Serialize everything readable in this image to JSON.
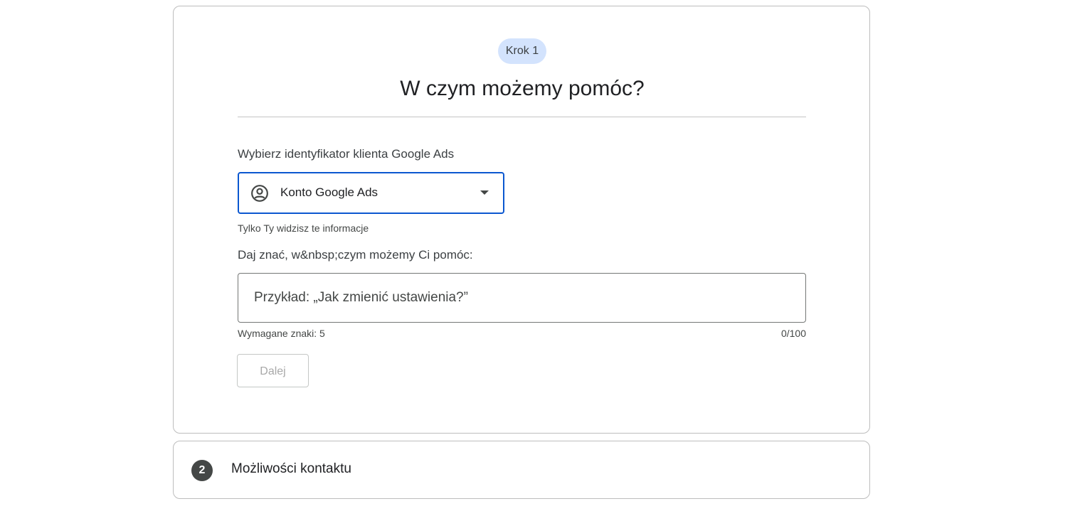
{
  "step1": {
    "chip_label": "Krok 1",
    "title": "W czym możemy pomóc?",
    "account_label": "Wybierz identyfikator klienta Google Ads",
    "account_select": {
      "value": "Konto Google Ads",
      "icon": "account-circle-icon"
    },
    "privacy_note": "Tylko Ty widzisz te informacje",
    "help_label": "Daj znać, w&nbsp;czym możemy Ci pomóc:",
    "help_input": {
      "value": "",
      "placeholder": "Przykład: „Jak zmienić ustawienia?”"
    },
    "required_chars": "Wymagane znaki: 5",
    "char_counter": "0/100",
    "next_button": "Dalej"
  },
  "step2": {
    "number": "2",
    "title": "Możliwości kontaktu"
  },
  "colors": {
    "chip_bg": "#d3e3fd",
    "focus_border": "#0b57d0",
    "step_badge_bg": "#444746"
  }
}
